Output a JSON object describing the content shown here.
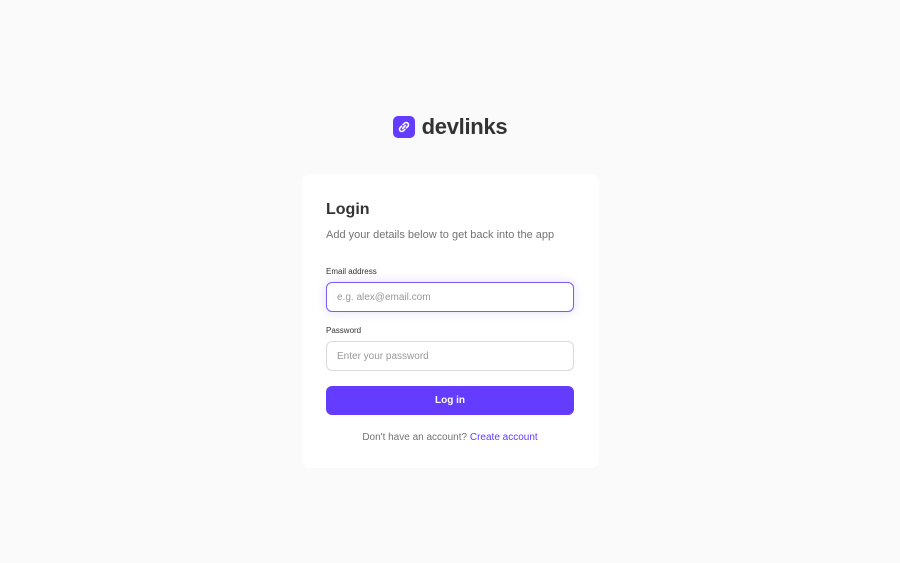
{
  "brand": {
    "name": "devlinks",
    "icon": "link-icon",
    "color": "#633cff"
  },
  "login": {
    "title": "Login",
    "subtitle": "Add your details below to get back into the app",
    "email": {
      "label": "Email address",
      "value": "",
      "placeholder": "e.g. alex@email.com"
    },
    "password": {
      "label": "Password",
      "value": "",
      "placeholder": "Enter your password"
    },
    "submit_label": "Log in",
    "signup_prompt": "Don't have an account?",
    "signup_link": "Create account"
  },
  "colors": {
    "accent": "#633cff",
    "background": "#fafafa",
    "card": "#ffffff",
    "text": "#333333",
    "muted": "#737373",
    "border": "#d9d9d9",
    "focus_border": "#7b5cf6"
  }
}
